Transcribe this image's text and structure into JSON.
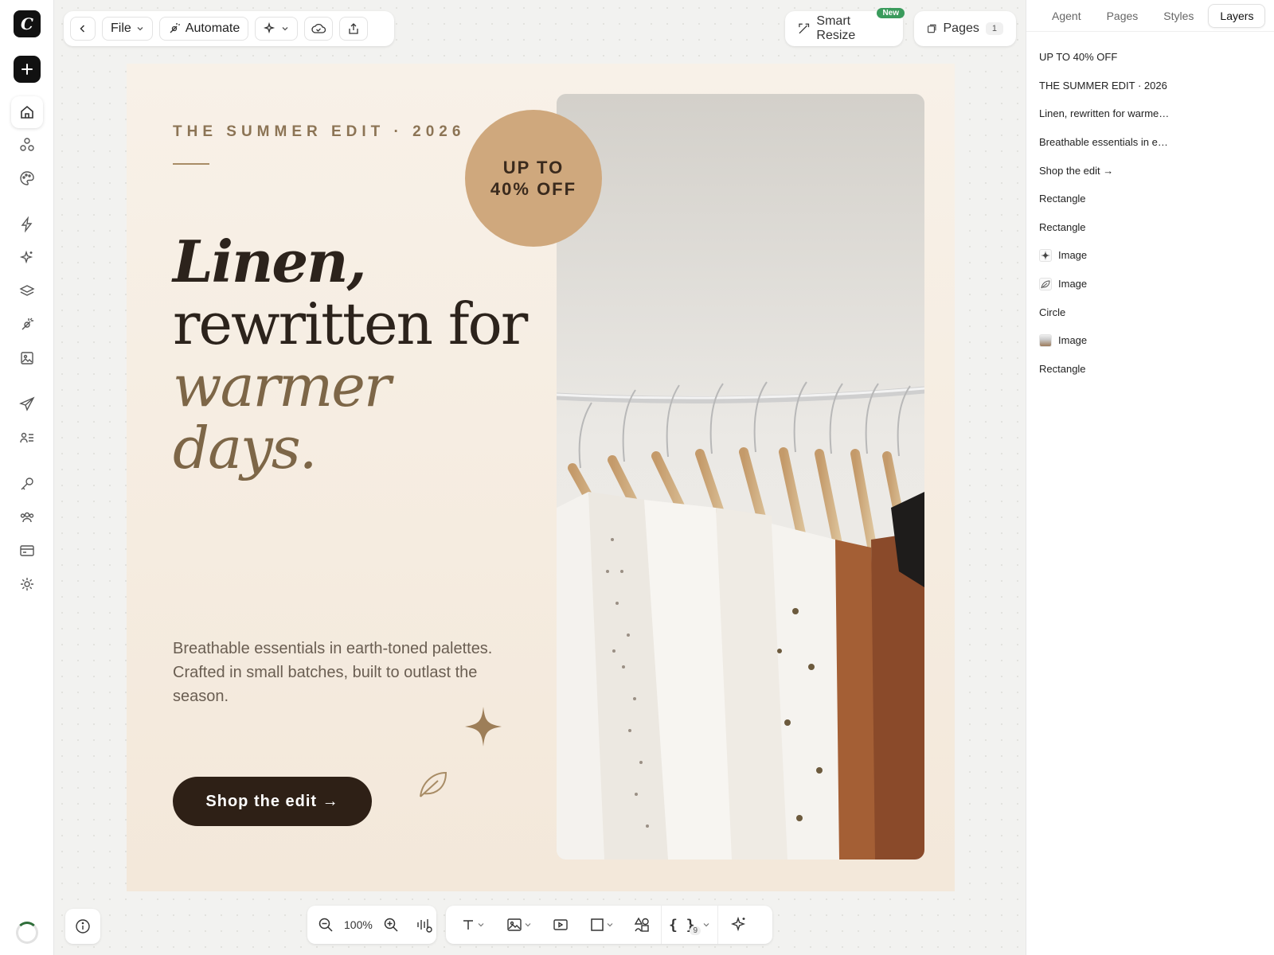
{
  "app": {
    "logo_glyph": "C"
  },
  "left_rail": {
    "items": [
      {
        "icon": "home-icon",
        "active": true
      },
      {
        "icon": "nodes-icon"
      },
      {
        "icon": "palette-icon"
      },
      {
        "icon": "lightning-icon"
      },
      {
        "icon": "sparkles-icon"
      },
      {
        "icon": "layers-icon"
      },
      {
        "icon": "magic-wand-icon"
      },
      {
        "icon": "image-icon"
      },
      {
        "icon": "send-icon"
      },
      {
        "icon": "contacts-icon"
      },
      {
        "icon": "key-icon"
      },
      {
        "icon": "team-icon"
      },
      {
        "icon": "billing-icon"
      },
      {
        "icon": "settings-icon"
      }
    ]
  },
  "toolbar": {
    "file_label": "File",
    "automate_label": "Automate"
  },
  "top_right": {
    "smart_resize_label": "Smart Resize",
    "new_badge": "New",
    "pages_label": "Pages",
    "pages_count": "1"
  },
  "design": {
    "eyebrow": "THE SUMMER EDIT · 2026",
    "headline_line1": "Linen,",
    "headline_line2": "rewritten for",
    "headline_line3": "warmer days.",
    "badge_line1": "UP TO",
    "badge_line2": "40% OFF",
    "body": "Breathable essentials in earth-toned palettes. Crafted in small batches, built to outlast the season.",
    "cta": "Shop the edit →",
    "colors": {
      "background": "#f6eee3",
      "headline": "#2c231c",
      "accent": "#7d6647",
      "badge": "#cfa87d",
      "cta": "#2e2016"
    }
  },
  "bottom_toolbar": {
    "zoom": "100%",
    "variables_count": "9"
  },
  "panel": {
    "tabs": [
      "Agent",
      "Pages",
      "Styles",
      "Layers"
    ],
    "selected_tab": "Layers",
    "layers": [
      {
        "label": "UP TO 40% OFF",
        "thumb": ""
      },
      {
        "label": "THE SUMMER EDIT · 2026",
        "thumb": ""
      },
      {
        "label": "Linen, rewritten for warme…",
        "thumb": ""
      },
      {
        "label": "Breathable essentials in e…",
        "thumb": ""
      },
      {
        "label": "Shop the edit →",
        "thumb": ""
      },
      {
        "label": "Rectangle",
        "thumb": ""
      },
      {
        "label": "Rectangle",
        "thumb": ""
      },
      {
        "label": "Image",
        "thumb": "sparkle"
      },
      {
        "label": "Image",
        "thumb": "leaf"
      },
      {
        "label": "Circle",
        "thumb": ""
      },
      {
        "label": "Image",
        "thumb": "photo"
      },
      {
        "label": "Rectangle",
        "thumb": ""
      }
    ]
  }
}
